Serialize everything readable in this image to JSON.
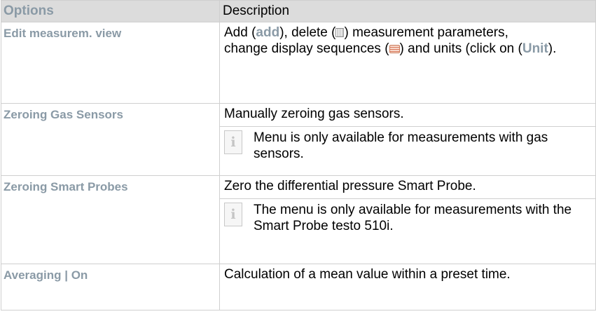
{
  "table": {
    "header": {
      "options": "Options",
      "description": "Description"
    },
    "rows": [
      {
        "option": "Edit measurem. view",
        "desc": {
          "t1": "Add (",
          "add": "add",
          "t2": "), delete (",
          "t3": ") measurement parameters,",
          "t4": "change display sequences (",
          "t5": ") and units (click on (",
          "unit": "Unit",
          "t6": ")."
        }
      },
      {
        "option": "Zeroing Gas Sensors",
        "desc": "Manually zeroing gas sensors.",
        "note": "Menu is only available for measurements with gas sensors."
      },
      {
        "option": "Zeroing Smart Probes",
        "desc": "Zero the differential pressure Smart Probe.",
        "note": "The menu is only available for measurements with the Smart Probe testo 510i."
      },
      {
        "option": "Averaging | On",
        "desc": "Calculation of a mean value within a preset time."
      }
    ]
  },
  "icons": {
    "info": "i",
    "trash": "trash-icon",
    "sequence": "list-order-icon",
    "info_name": "info-icon"
  },
  "colors": {
    "option_text": "#8a9aa6",
    "header_bg": "#dcdcdc",
    "border": "#cfcfcf"
  }
}
